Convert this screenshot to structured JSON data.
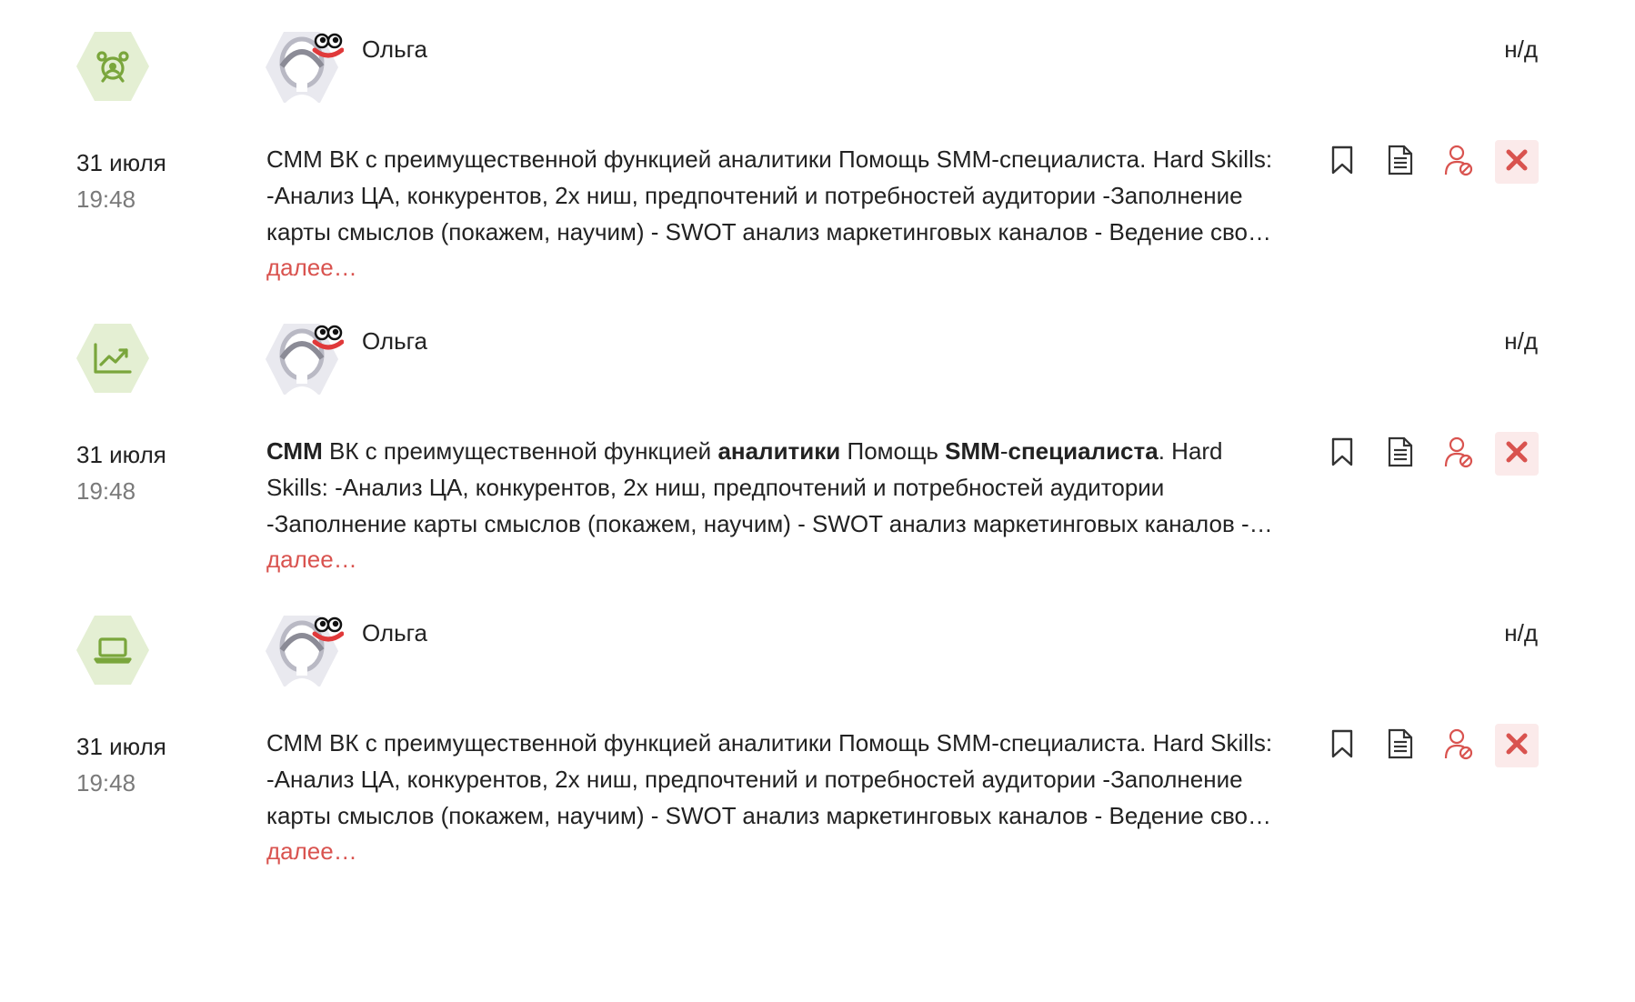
{
  "colors": {
    "accent_red": "#d9534f",
    "badge_bg": "#e4efd3",
    "badge_icon": "#7aa63c",
    "text_muted": "#7a7a7a"
  },
  "vacancies": [
    {
      "category_icon": "alarm-clock-icon",
      "author": "Ольга",
      "salary": "н/д",
      "date": "31 июля",
      "time": "19:48",
      "description_parts": [
        {
          "text": "СММ ВК с преимущественной функцией аналитики Помощь SMM-специалиста. Hard Skills: -Анализ ЦА, конкурентов, 2х ниш, предпочтений и потребностей аудитории -Заполнение карты смыслов (покажем, научим) - SWOT анализ маркетинговых каналов - Ведение своих проектов",
          "bold": false
        }
      ],
      "more_label": "далее…"
    },
    {
      "category_icon": "trending-up-chart-icon",
      "author": "Ольга",
      "salary": "н/д",
      "date": "31 июля",
      "time": "19:48",
      "description_parts": [
        {
          "text": "СММ",
          "bold": true
        },
        {
          "text": " ВК с преимущественной функцией ",
          "bold": false
        },
        {
          "text": "аналитики",
          "bold": true
        },
        {
          "text": " Помощь ",
          "bold": false
        },
        {
          "text": "SMM",
          "bold": true
        },
        {
          "text": "-",
          "bold": false
        },
        {
          "text": "специалиста",
          "bold": true
        },
        {
          "text": ". Hard Skills: -Анализ ЦА, конкурентов, 2х ниш, предпочтений и потребностей аудитории -Заполнение карты смыслов (покажем, научим) - SWOT анализ маркетинговых каналов - Ведение своих проектов",
          "bold": false
        }
      ],
      "more_label": "далее…"
    },
    {
      "category_icon": "laptop-icon",
      "author": "Ольга",
      "salary": "н/д",
      "date": "31 июля",
      "time": "19:48",
      "description_parts": [
        {
          "text": "СММ ВК с преимущественной функцией аналитики Помощь SMM-специалиста. Hard Skills: -Анализ ЦА, конкурентов, 2х ниш, предпочтений и потребностей аудитории -Заполнение карты смыслов (покажем, научим) - SWOT анализ маркетинговых каналов - Ведение своих проектов",
          "bold": false
        }
      ],
      "more_label": "далее…"
    }
  ],
  "actions": [
    {
      "icon": "bookmark-icon"
    },
    {
      "icon": "document-icon"
    },
    {
      "icon": "block-employer-icon"
    },
    {
      "icon": "close-icon"
    }
  ]
}
